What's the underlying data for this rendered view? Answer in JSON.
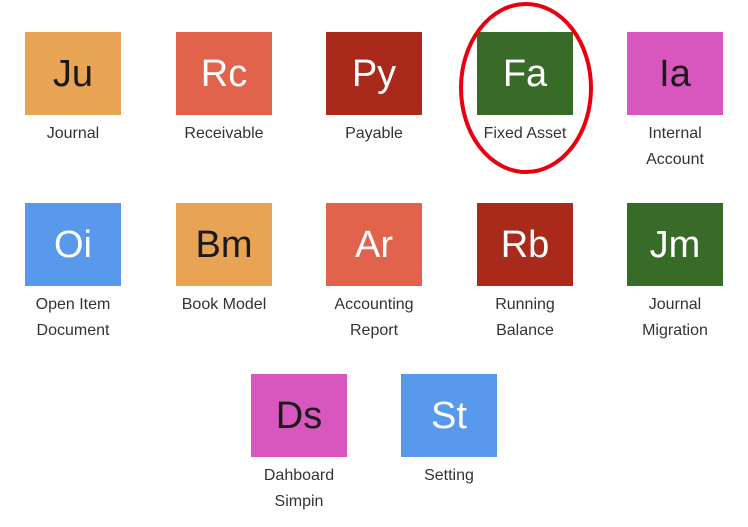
{
  "modules": [
    {
      "abbr": "Ju",
      "name_line1": "Journal",
      "name_line2": "",
      "bg": "#E8A355",
      "fg": "#1a1a1a"
    },
    {
      "abbr": "Rc",
      "name_line1": "Receivable",
      "name_line2": "",
      "bg": "#E2634C",
      "fg": "#ffffff"
    },
    {
      "abbr": "Py",
      "name_line1": "Payable",
      "name_line2": "",
      "bg": "#A9291A",
      "fg": "#ffffff"
    },
    {
      "abbr": "Fa",
      "name_line1": "Fixed Asset",
      "name_line2": "",
      "bg": "#386B27",
      "fg": "#ffffff"
    },
    {
      "abbr": "Ia",
      "name_line1": "Internal",
      "name_line2": "Account",
      "bg": "#D857BE",
      "fg": "#1a1a1a"
    },
    {
      "abbr": "Oi",
      "name_line1": "Open Item",
      "name_line2": "Document",
      "bg": "#5899EC",
      "fg": "#ffffff"
    },
    {
      "abbr": "Bm",
      "name_line1": "Book Model",
      "name_line2": "",
      "bg": "#E8A355",
      "fg": "#1a1a1a"
    },
    {
      "abbr": "Ar",
      "name_line1": "Accounting",
      "name_line2": "Report",
      "bg": "#E2634C",
      "fg": "#ffffff"
    },
    {
      "abbr": "Rb",
      "name_line1": "Running",
      "name_line2": "Balance",
      "bg": "#A9291A",
      "fg": "#ffffff"
    },
    {
      "abbr": "Jm",
      "name_line1": "Journal",
      "name_line2": "Migration",
      "bg": "#386B27",
      "fg": "#ffffff"
    },
    {
      "abbr": "Ds",
      "name_line1": "Dahboard",
      "name_line2": "Simpin",
      "bg": "#D857BE",
      "fg": "#1a1a1a"
    },
    {
      "abbr": "St",
      "name_line1": "Setting",
      "name_line2": "",
      "bg": "#5899EC",
      "fg": "#ffffff"
    }
  ],
  "highlight": {
    "module": "Fa",
    "color": "#E8000F"
  }
}
